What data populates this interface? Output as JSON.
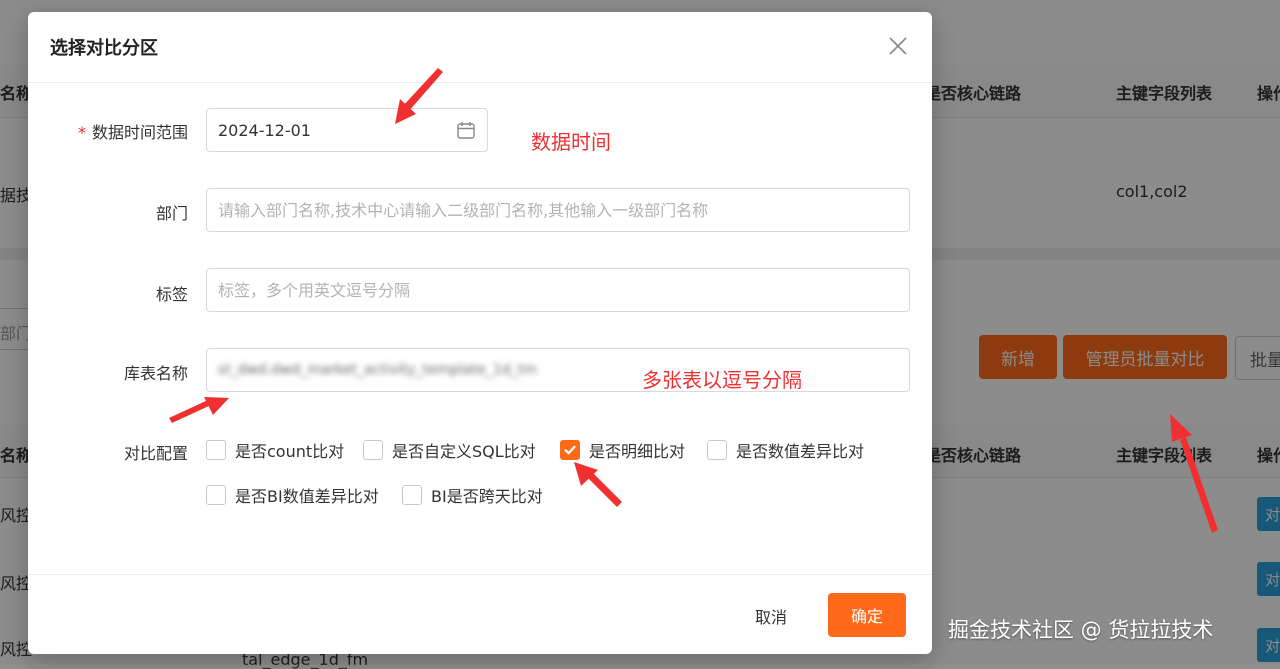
{
  "background": {
    "col_name_fragment": "名称",
    "col_core_link": "是否核心链路",
    "col_primary_keys": "主键字段列表",
    "col_ops_fragment": "操作",
    "row1_name_fragment": "据技",
    "row1_keys": "col1,col2",
    "dept_fragment": "部门",
    "btn_new": "新增",
    "btn_admin_batch": "管理员批量对比",
    "btn_batch_fragment": "批量",
    "row_name_fragment": "风控",
    "row_ops_fragment": "对",
    "table_fragment": "tal_edge_1d_fm",
    "col_core_link2": "是否核心链路",
    "col_primary_keys2": "主键字段列表"
  },
  "modal": {
    "title": "选择对比分区",
    "form": {
      "date_label": "数据时间范围",
      "date_value": "2024-12-01",
      "dept_label": "部门",
      "dept_placeholder": "请输入部门名称,技术中心请输入二级部门名称,其他输入一级部门名称",
      "tag_label": "标签",
      "tag_placeholder": "标签，多个用英文逗号分隔",
      "table_label": "库表名称",
      "table_value": "ol_dwd.dwd_market_activity_template_1d_tm",
      "compare_label": "对比配置",
      "options": [
        {
          "label": "是否count比对",
          "checked": false
        },
        {
          "label": "是否自定义SQL比对",
          "checked": false
        },
        {
          "label": "是否明细比对",
          "checked": true
        },
        {
          "label": "是否数值差异比对",
          "checked": false
        },
        {
          "label": "是否BI数值差异比对",
          "checked": false
        },
        {
          "label": "BI是否跨天比对",
          "checked": false
        }
      ]
    },
    "cancel_label": "取消",
    "ok_label": "确定"
  },
  "annotations": {
    "date_note": "数据时间",
    "table_note": "多张表以逗号分隔"
  },
  "credit": "掘金技术社区 @ 货拉拉技术",
  "colors": {
    "accent": "#ff6a1a",
    "annotation": "#f03030",
    "required": "#f5222d"
  }
}
